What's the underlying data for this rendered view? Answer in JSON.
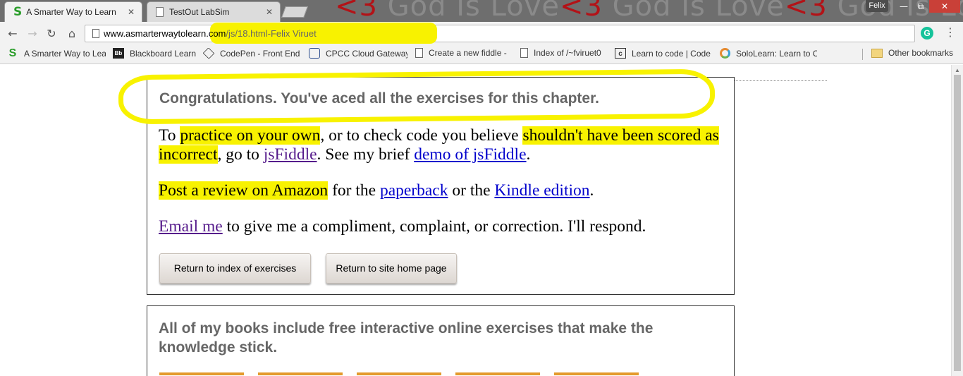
{
  "browser": {
    "tabs": [
      {
        "label": "A Smarter Way to Learn J",
        "active": true,
        "favicon": "s-icon"
      },
      {
        "label": "TestOut LabSim",
        "active": false,
        "favicon": "document-icon"
      }
    ],
    "wallpaper_text": {
      "heart": "<3",
      "phrase": " God Is Love"
    },
    "profile_name": "Felix",
    "window_buttons": {
      "minimize": "—",
      "maximize": "⧉",
      "close": "✕"
    },
    "nav": {
      "back": "←",
      "forward": "→",
      "reload": "↻",
      "home": "⌂",
      "menu": "⋮"
    },
    "url": {
      "host": "www.asmarterwaytolearn.com",
      "path": "/js/18.html-Felix Viruet"
    },
    "grammarly": "G",
    "bookmarks": [
      {
        "label": "A Smarter Way to Lea",
        "icon": "s-icon"
      },
      {
        "label": "Blackboard Learn",
        "icon": "blackboard-icon"
      },
      {
        "label": "CodePen - Front End",
        "icon": "codepen-icon"
      },
      {
        "label": "CPCC Cloud Gateway",
        "icon": "cpcc-icon"
      },
      {
        "label": "Create a new fiddle -",
        "icon": "document-icon"
      },
      {
        "label": "Index of /~fviruet0",
        "icon": "document-icon"
      },
      {
        "label": "Learn to code | Code",
        "icon": "codecademy-icon"
      },
      {
        "label": "SoloLearn: Learn to C",
        "icon": "sololearn-icon"
      }
    ],
    "other_bookmarks": "Other bookmarks",
    "highlight_color": "#f8f200"
  },
  "page": {
    "congrats": "Congratulations. You've aced all the exercises for this chapter.",
    "para1": {
      "t1": "To ",
      "h1": "practice on your own",
      "t2": ", or to check code you believe ",
      "h2": "shouldn't have been scored as incorrect",
      "t3": ", go to ",
      "link1": "jsFiddle",
      "t4": ". See my brief ",
      "link2": "demo of jsFiddle",
      "t5": "."
    },
    "para2": {
      "h1": "Post a review on Amazon",
      "t1": " for the ",
      "link1": "paperback",
      "t2": " or the ",
      "link2": "Kindle edition",
      "t3": "."
    },
    "para3": {
      "link1": "Email me",
      "t1": " to give me a compliment, complaint, or correction. I'll respond."
    },
    "buttons": {
      "index": "Return to index of exercises",
      "home": "Return to site home page"
    },
    "books_text": "All of my books include free interactive online exercises that make the knowledge stick."
  }
}
